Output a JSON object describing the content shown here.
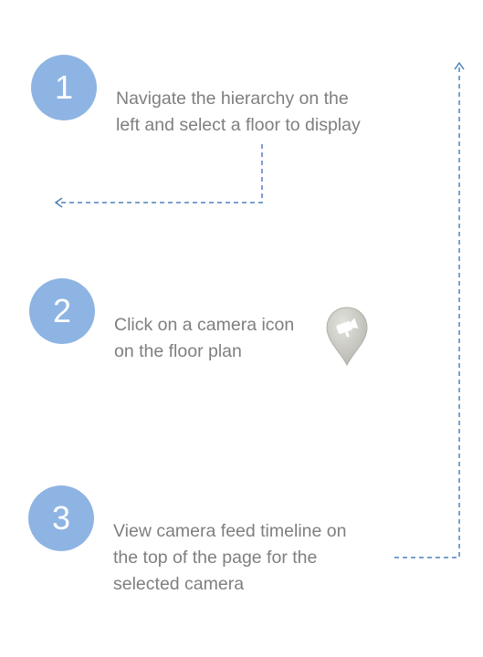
{
  "colors": {
    "step_circle": "#8eb4e3",
    "step_text": "#7f7f7f",
    "arrow": "#4f81bd",
    "pin": "#c8c8c2"
  },
  "steps": [
    {
      "number": "1",
      "lines": [
        "Navigate the hierarchy on the",
        "left and select a floor to display"
      ]
    },
    {
      "number": "2",
      "lines": [
        "Click on a camera icon",
        "on the floor plan"
      ]
    },
    {
      "number": "3",
      "lines": [
        "View camera feed timeline on",
        "the top of the page for the",
        "selected camera"
      ]
    }
  ],
  "icons": {
    "camera_pin": "camera-pin-icon"
  }
}
